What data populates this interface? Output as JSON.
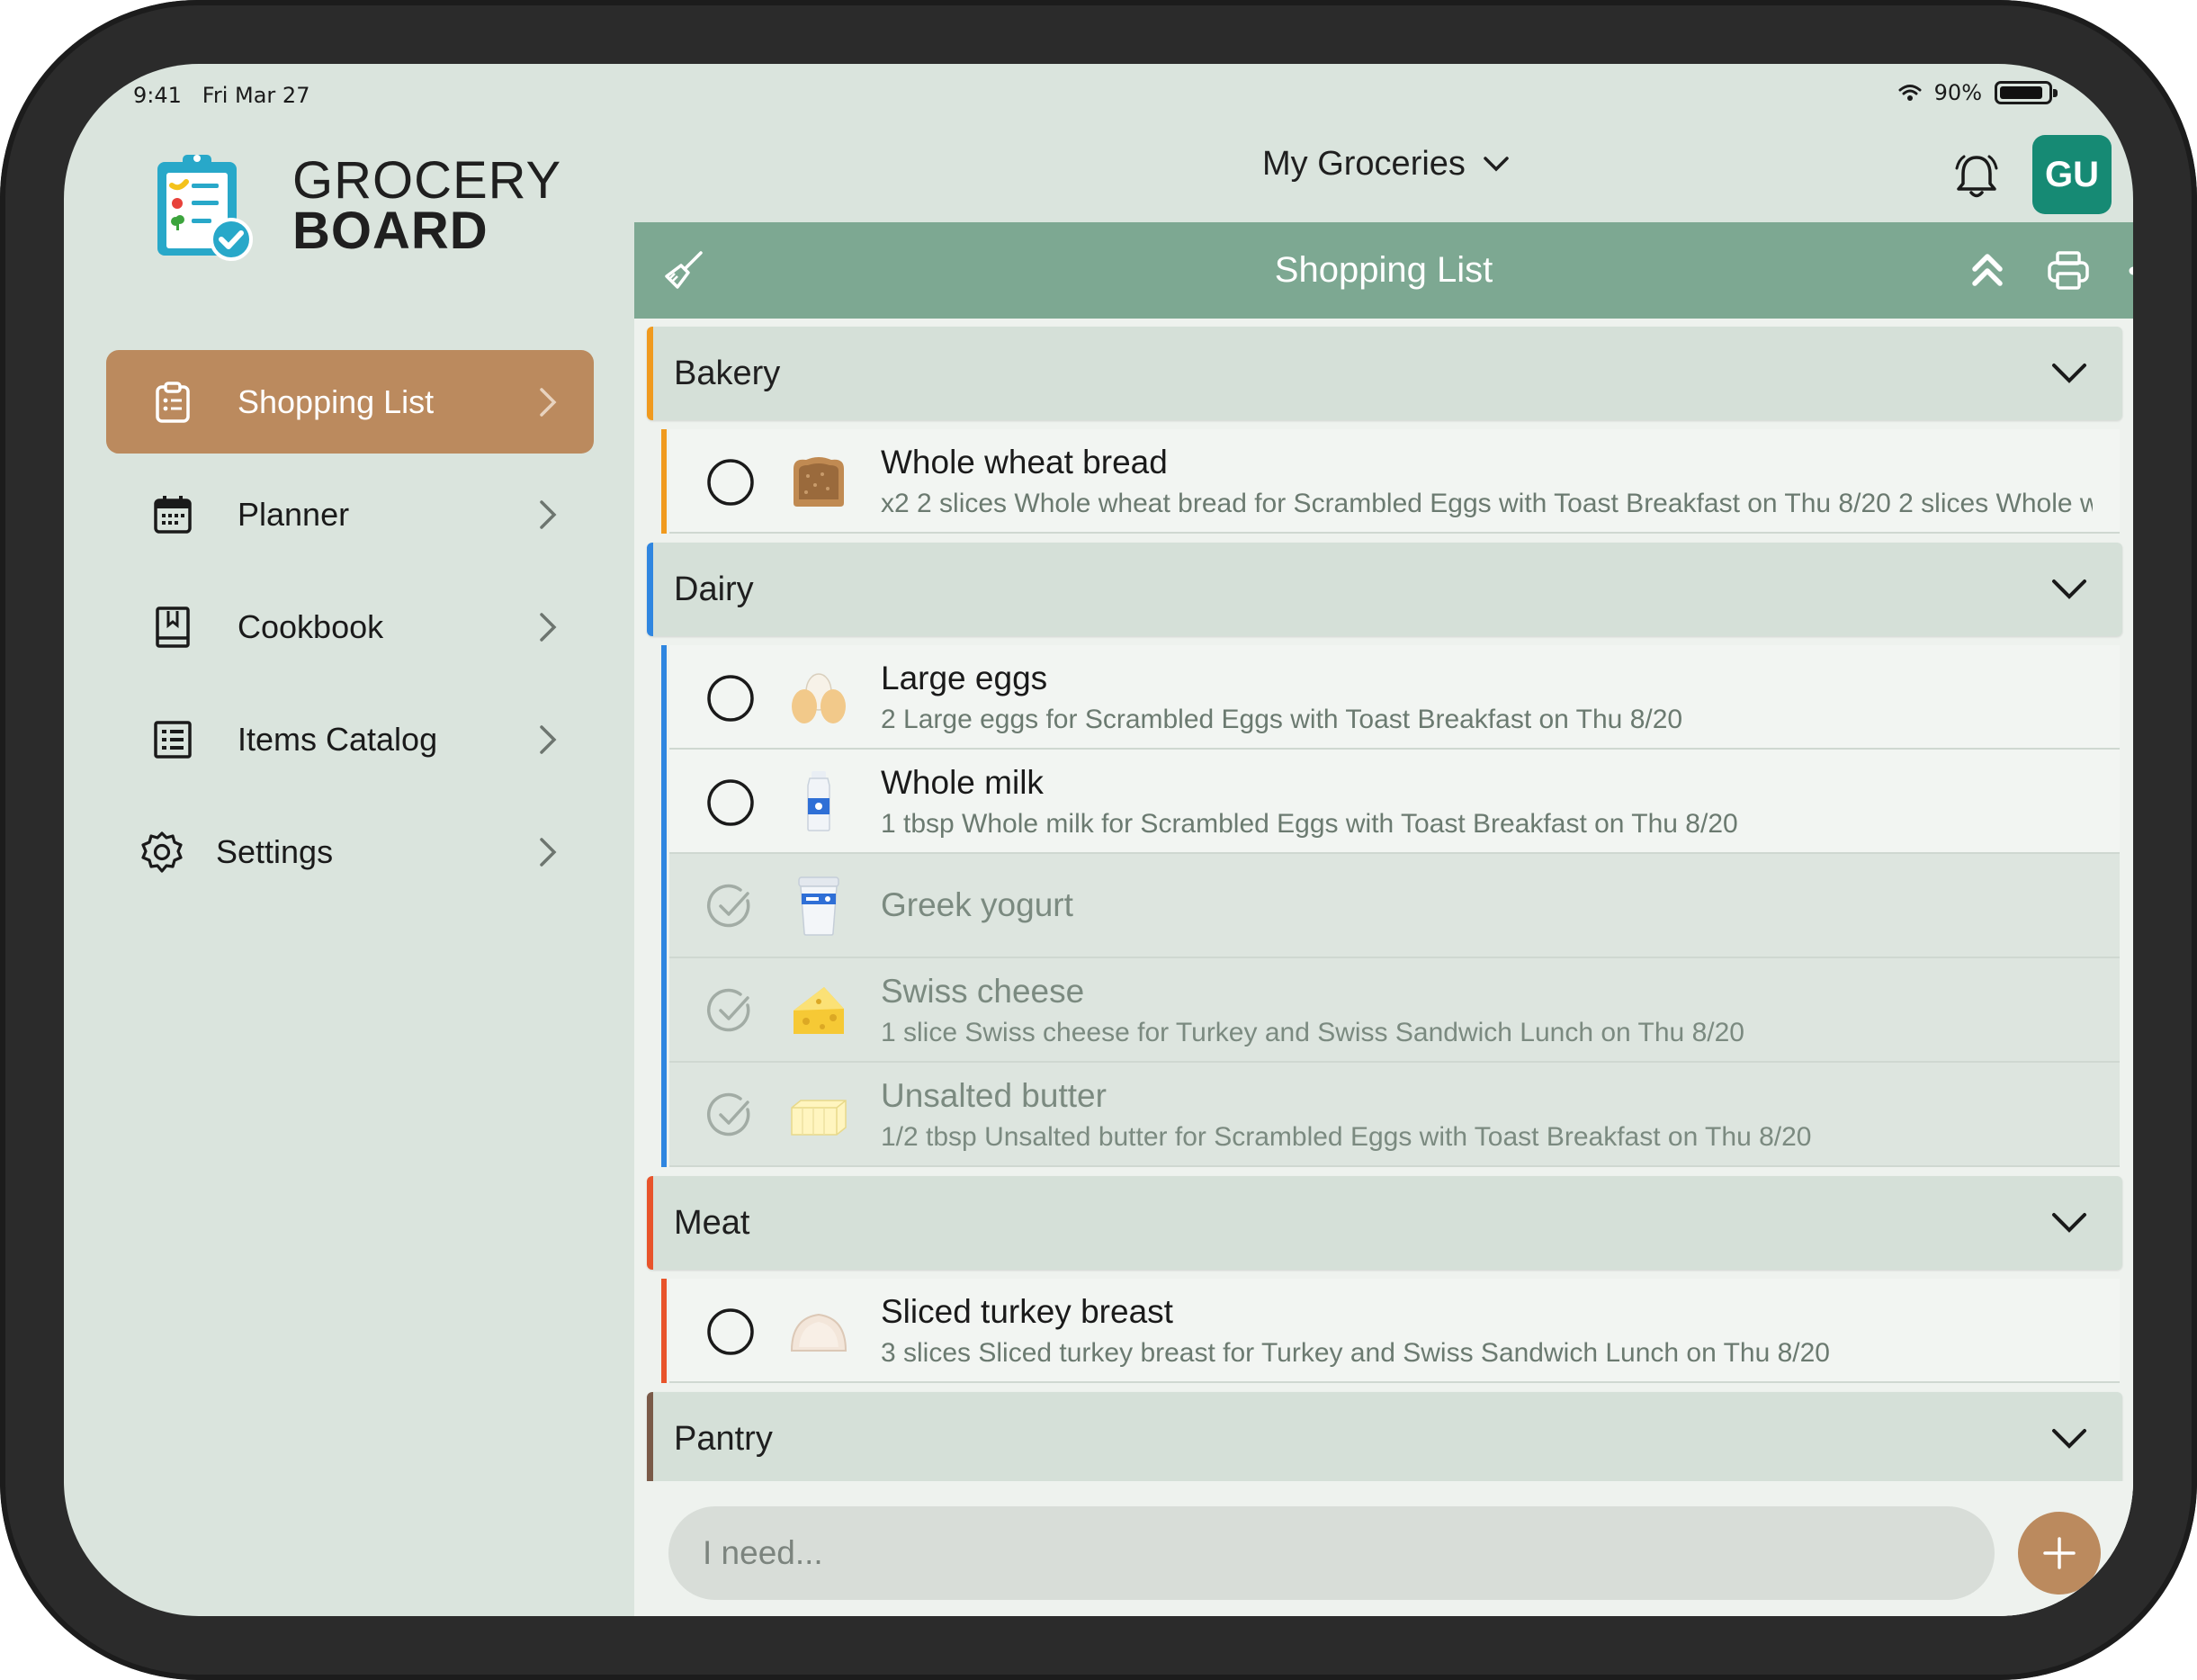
{
  "status_bar": {
    "time": "9:41",
    "date": "Fri Mar 27",
    "battery": "90%"
  },
  "brand": {
    "line1": "GROCERY",
    "line2": "BOARD"
  },
  "nav": [
    {
      "label": "Shopping List",
      "icon": "clipboard-icon",
      "active": true
    },
    {
      "label": "Planner",
      "icon": "calendar-icon"
    },
    {
      "label": "Cookbook",
      "icon": "book-icon"
    },
    {
      "label": "Items Catalog",
      "icon": "list-icon"
    },
    {
      "label": "Settings",
      "icon": "gear-icon"
    }
  ],
  "header": {
    "list_name": "My Groceries",
    "avatar_initials": "GU"
  },
  "toolbar": {
    "title": "Shopping List"
  },
  "colors": {
    "accent": "#bb8a5e",
    "toolbar": "#7da892",
    "avatar": "#168a74",
    "bakery": "#f09a1e",
    "dairy": "#2f86e0",
    "meat": "#e8542b",
    "pantry": "#7a5a48"
  },
  "categories": [
    {
      "name": "Bakery",
      "items": [
        {
          "name": "Whole wheat bread",
          "desc": "x2 2 slices Whole wheat bread for Scrambled Eggs with Toast Breakfast on Thu 8/20 2 slices Whole w",
          "checked": false,
          "icon": "bread-icon"
        }
      ]
    },
    {
      "name": "Dairy",
      "items": [
        {
          "name": "Large eggs",
          "desc": "2 Large eggs for Scrambled Eggs with Toast Breakfast on Thu 8/20",
          "checked": false,
          "icon": "eggs-icon"
        },
        {
          "name": "Whole milk",
          "desc": "1 tbsp Whole milk for Scrambled Eggs with Toast Breakfast on Thu 8/20",
          "checked": false,
          "icon": "milk-icon"
        },
        {
          "name": "Greek yogurt",
          "desc": "",
          "checked": true,
          "icon": "yogurt-icon"
        },
        {
          "name": "Swiss cheese",
          "desc": "1 slice Swiss cheese for Turkey and Swiss Sandwich Lunch on Thu 8/20",
          "checked": true,
          "icon": "cheese-icon"
        },
        {
          "name": "Unsalted butter",
          "desc": "1/2 tbsp Unsalted butter for Scrambled Eggs with Toast Breakfast on Thu 8/20",
          "checked": true,
          "icon": "butter-icon"
        }
      ]
    },
    {
      "name": "Meat",
      "items": [
        {
          "name": "Sliced turkey breast",
          "desc": "3 slices Sliced turkey breast for Turkey and Swiss Sandwich Lunch on Thu 8/20",
          "checked": false,
          "icon": "turkey-icon"
        }
      ]
    },
    {
      "name": "Pantry",
      "items": []
    }
  ],
  "input": {
    "placeholder": "I need..."
  }
}
